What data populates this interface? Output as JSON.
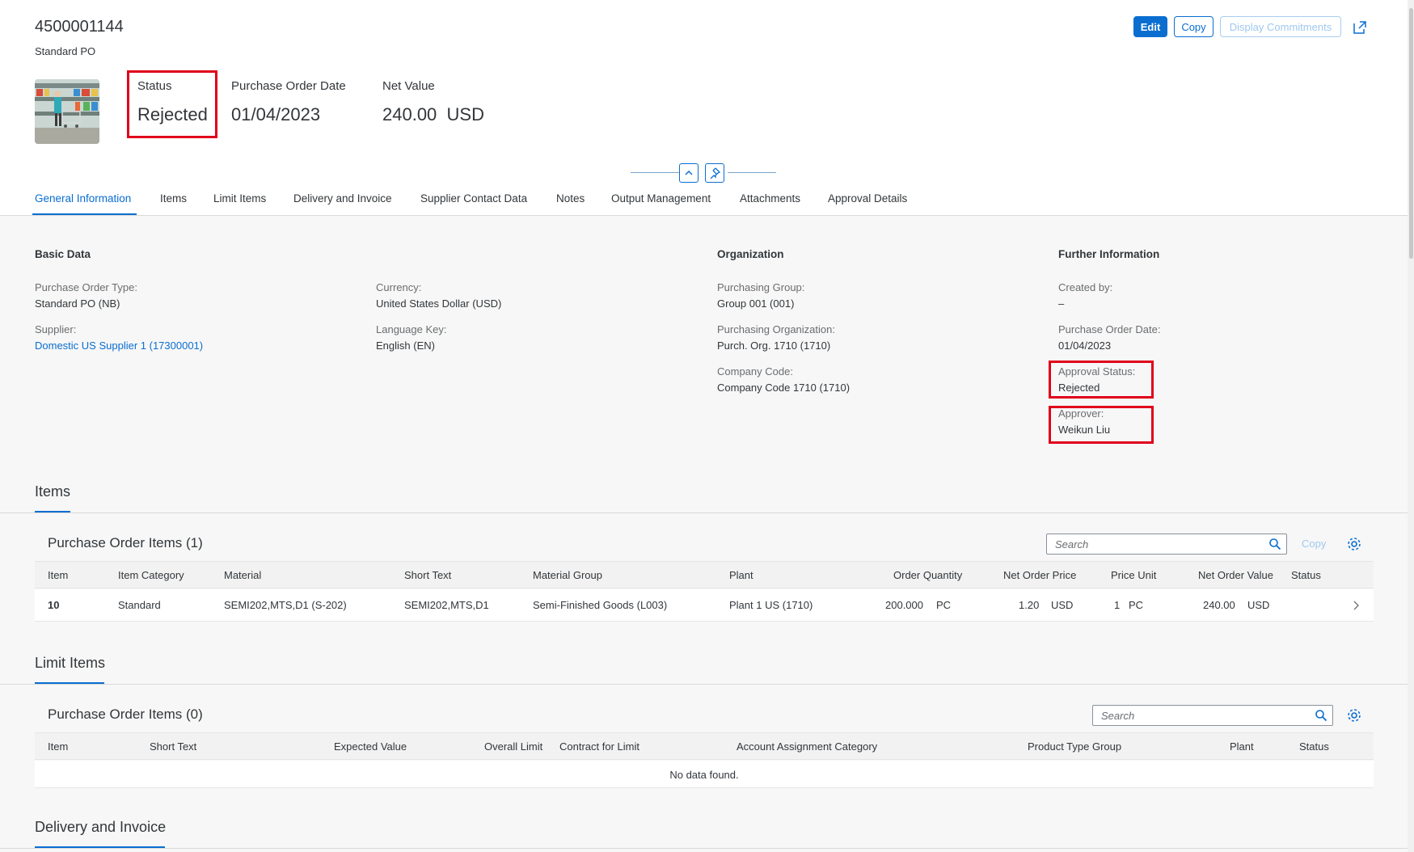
{
  "header": {
    "title": "4500001144",
    "subtitle": "Standard PO",
    "actions": {
      "edit": "Edit",
      "copy": "Copy",
      "display_commitments": "Display Commitments"
    },
    "kpis": {
      "status_label": "Status",
      "status_value": "Rejected",
      "date_label": "Purchase Order Date",
      "date_value": "01/04/2023",
      "net_label": "Net Value",
      "net_value": "240.00",
      "net_currency": "USD"
    }
  },
  "tabs": [
    "General Information",
    "Items",
    "Limit Items",
    "Delivery and Invoice",
    "Supplier Contact Data",
    "Notes",
    "Output Management",
    "Attachments",
    "Approval Details"
  ],
  "general": {
    "basic_data": {
      "heading": "Basic Data",
      "po_type_label": "Purchase Order Type:",
      "po_type_value": "Standard PO (NB)",
      "supplier_label": "Supplier:",
      "supplier_value": "Domestic US Supplier 1 (17300001)",
      "currency_label": "Currency:",
      "currency_value": "United States Dollar (USD)",
      "language_label": "Language Key:",
      "language_value": "English (EN)"
    },
    "organization": {
      "heading": "Organization",
      "purch_group_label": "Purchasing Group:",
      "purch_group_value": "Group 001 (001)",
      "purch_org_label": "Purchasing Organization:",
      "purch_org_value": "Purch. Org. 1710 (1710)",
      "company_label": "Company Code:",
      "company_value": "Company Code 1710 (1710)"
    },
    "further": {
      "heading": "Further Information",
      "created_label": "Created by:",
      "created_value": "–",
      "date_label": "Purchase Order Date:",
      "date_value": "01/04/2023",
      "approval_label": "Approval Status:",
      "approval_value": "Rejected",
      "approver_label": "Approver:",
      "approver_value": "Weikun Liu"
    }
  },
  "items_section": {
    "title": "Items",
    "table_title": "Purchase Order Items (1)",
    "search_placeholder": "Search",
    "copy_label": "Copy",
    "columns": [
      "Item",
      "Item Category",
      "Material",
      "Short Text",
      "Material Group",
      "Plant",
      "Order Quantity",
      "Net Order Price",
      "Price Unit",
      "Net Order Value",
      "Status"
    ],
    "rows": [
      {
        "item": "10",
        "category": "Standard",
        "material": "SEMI202,MTS,D1 (S-202)",
        "short_text": "SEMI202,MTS,D1",
        "material_group": "Semi-Finished Goods (L003)",
        "plant": "Plant 1 US (1710)",
        "qty": "200.000",
        "qty_unit": "PC",
        "price": "1.20",
        "price_cur": "USD",
        "price_unit": "1",
        "price_unit_uom": "PC",
        "value": "240.00",
        "value_cur": "USD",
        "status": ""
      }
    ]
  },
  "limit_section": {
    "title": "Limit Items",
    "table_title": "Purchase Order Items (0)",
    "search_placeholder": "Search",
    "columns": [
      "Item",
      "Short Text",
      "Expected Value",
      "Overall Limit",
      "Contract for Limit",
      "Account Assignment Category",
      "Product Type Group",
      "Plant",
      "Status"
    ],
    "no_data": "No data found."
  },
  "delivery_section": {
    "title": "Delivery and Invoice"
  },
  "colors": {
    "accent": "#0a6ed1",
    "highlight": "#e0001a"
  }
}
